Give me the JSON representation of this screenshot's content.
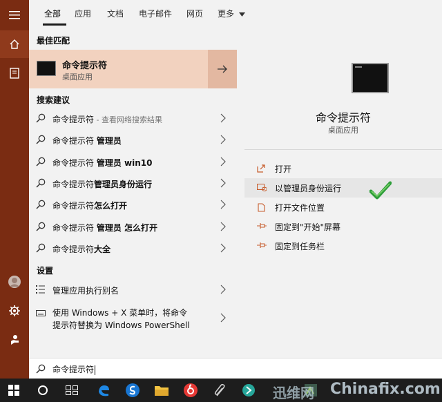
{
  "tabs": [
    {
      "label": "全部"
    },
    {
      "label": "应用"
    },
    {
      "label": "文档"
    },
    {
      "label": "电子邮件"
    },
    {
      "label": "网页"
    },
    {
      "label": "更多"
    }
  ],
  "sections": {
    "best_match": "最佳匹配",
    "search_suggestions": "搜索建议",
    "settings": "设置"
  },
  "best_match": {
    "title": "命令提示符",
    "subtitle": "桌面应用"
  },
  "suggestions": [
    {
      "prefix": "命令提示符",
      "bold": "",
      "suffix": " - 查看网络搜索结果"
    },
    {
      "prefix": "命令提示符 ",
      "bold": "管理员",
      "suffix": ""
    },
    {
      "prefix": "命令提示符 ",
      "bold": "管理员 win10",
      "suffix": ""
    },
    {
      "prefix": "命令提示符",
      "bold": "管理员身份运行",
      "suffix": ""
    },
    {
      "prefix": "命令提示符",
      "bold": "怎么打开",
      "suffix": ""
    },
    {
      "prefix": "命令提示符 ",
      "bold": "管理员 怎么打开",
      "suffix": ""
    },
    {
      "prefix": "命令提示符",
      "bold": "大全",
      "suffix": ""
    }
  ],
  "settings_items": [
    {
      "label": "管理应用执行别名"
    },
    {
      "line1": "使用 Windows + X 菜单时，将命令",
      "line2": "提示符替换为 Windows PowerShell"
    }
  ],
  "detail": {
    "title": "命令提示符",
    "subtitle": "桌面应用",
    "actions": [
      {
        "label": "打开"
      },
      {
        "label": "以管理员身份运行"
      },
      {
        "label": "打开文件位置"
      },
      {
        "label": "固定到\"开始\"屏幕"
      },
      {
        "label": "固定到任务栏"
      }
    ]
  },
  "search": {
    "query": "命令提示符"
  },
  "watermark": {
    "text1": "迅维网",
    "text2": "Chinafix.com"
  },
  "colors": {
    "rail": "#7a2c12",
    "best_match_bg": "#f2d2bf",
    "accent_icon": "#c75b2a",
    "check": "#2e9e3a",
    "taskbar": "#1d1d1d"
  }
}
